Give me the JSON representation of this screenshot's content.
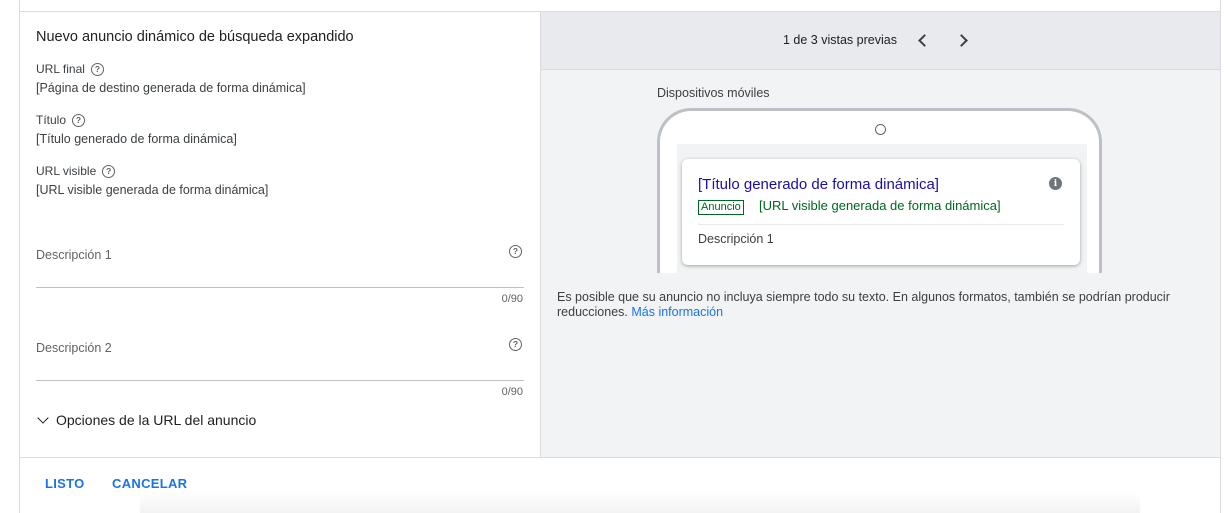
{
  "editor": {
    "title": "Nuevo anuncio dinámico de búsqueda expandido",
    "fields": [
      {
        "label": "URL final",
        "value": "[Página de destino generada de forma dinámica]"
      },
      {
        "label": "Título",
        "value": "[Título generado de forma dinámica]"
      },
      {
        "label": "URL visible",
        "value": "[URL visible generada de forma dinámica]"
      }
    ],
    "descriptions": [
      {
        "label": "Descripción 1",
        "value": "",
        "counter": "0/90"
      },
      {
        "label": "Descripción 2",
        "value": "",
        "counter": "0/90"
      }
    ],
    "url_options_label": "Opciones de la URL del anuncio"
  },
  "preview": {
    "pager_text": "1 de 3 vistas previas",
    "device_label": "Dispositivos móviles",
    "ad": {
      "headline": "[Título generado de forma dinámica]",
      "badge": "Anuncio",
      "display_url": "[URL visible generada de forma dinámica]",
      "description": "Descripción 1"
    },
    "notice_text": "Es posible que su anuncio no incluya siempre todo su texto. En algunos formatos, también se podrían producir reducciones.",
    "notice_link": "Más información"
  },
  "footer": {
    "done_label": "LISTO",
    "cancel_label": "CANCELAR"
  },
  "icons": {
    "help": "help-circle-icon",
    "info": "info-icon",
    "prev": "chevron-left-icon",
    "next": "chevron-right-icon",
    "expand": "chevron-down-icon"
  },
  "colors": {
    "accent": "#1a73e8",
    "ad_headline": "#1a0dab",
    "ad_url": "#006621"
  }
}
